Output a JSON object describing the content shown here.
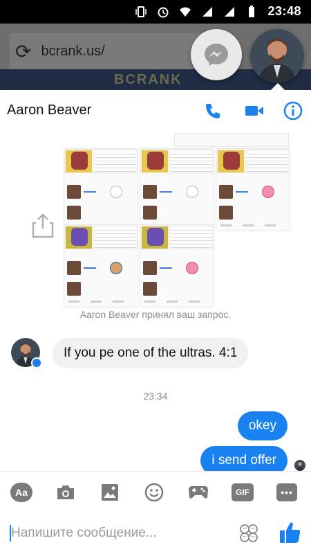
{
  "status_bar": {
    "time": "23:48",
    "icons": [
      "vibrate-icon",
      "alarm-icon",
      "wifi-icon",
      "signal-icon",
      "signal-icon",
      "battery-icon"
    ]
  },
  "browser": {
    "url": "bcrank.us/",
    "site_brand": "BCRANK"
  },
  "chat_header": {
    "contact_name": "Aaron Beaver",
    "actions": [
      "phone-icon",
      "video-call-icon",
      "info-icon"
    ]
  },
  "thumbnails": [
    {
      "badge": "OFF",
      "variant": "red"
    },
    {
      "badge": "OFF",
      "variant": "red"
    },
    {
      "badge": "pink",
      "variant": "red"
    },
    {
      "badge": "shield",
      "variant": "purple"
    },
    {
      "badge": "pink",
      "variant": "purple"
    }
  ],
  "messages": {
    "system_note": "Aaron Beaver принял ваш запрос.",
    "incoming": "If you pe one of the ultras. 4:1",
    "timestamp": "23:34",
    "outgoing": [
      "okey",
      "i send offer"
    ]
  },
  "toolbar": {
    "aa_label": "Aa",
    "gif_label": "GIF",
    "more_label": "•••",
    "items": [
      "text-format-icon",
      "camera-icon",
      "image-icon",
      "emoji-icon",
      "game-icon",
      "gif-icon",
      "more-icon"
    ]
  },
  "composer": {
    "placeholder": "Напишите сообщение..."
  },
  "colors": {
    "accent": "#1a82f0",
    "incoming_bubble": "#f1f0f0",
    "toolbar_icon": "#7a7a7a"
  }
}
